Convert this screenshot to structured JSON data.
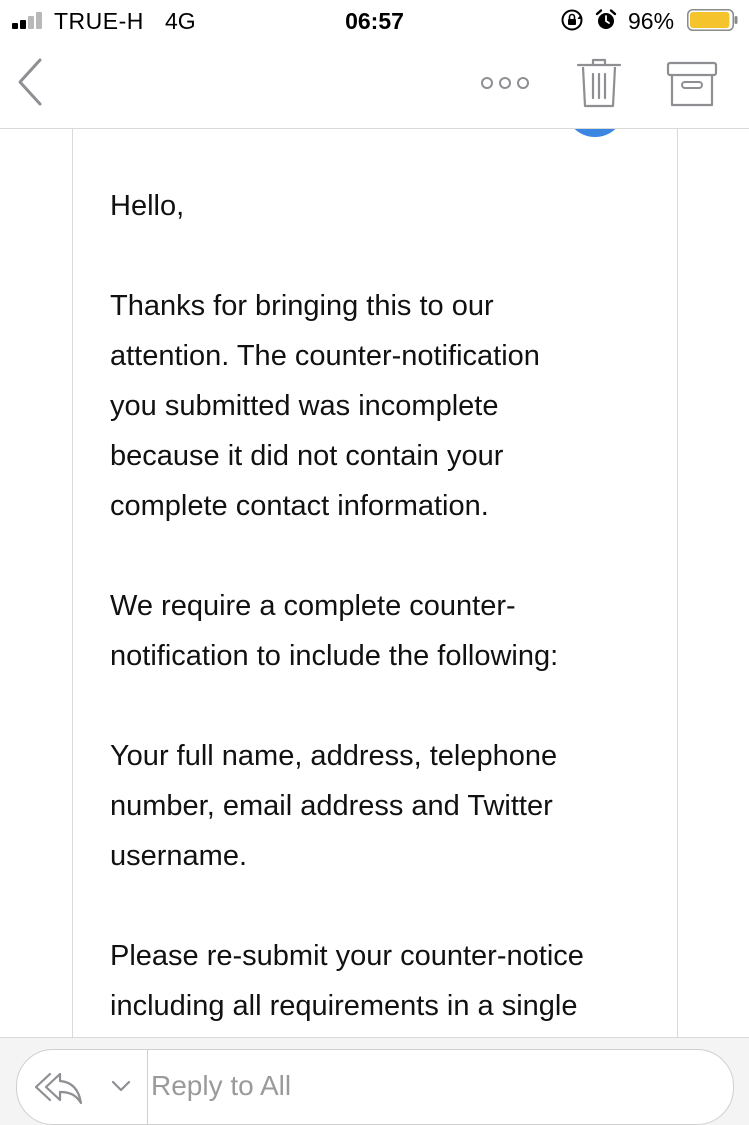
{
  "status_bar": {
    "carrier": "TRUE-H",
    "network": "4G",
    "time": "06:57",
    "battery_percent": "96%",
    "battery_level": 0.96,
    "battery_color": "#f5c32c",
    "signal_bars_active": 2,
    "signal_bars_total": 4
  },
  "toolbar": {
    "back_icon": "chevron-left-icon",
    "more_icon": "more-horizontal-icon",
    "trash_icon": "trash-icon",
    "archive_icon": "archive-icon",
    "accent_color": "#8e8e93"
  },
  "message": {
    "avatar_color": "#3b86e0",
    "paragraphs": [
      "Hello,",
      "Thanks for bringing this to our\nattention. The counter-notification\nyou submitted was incomplete\nbecause it did not contain your\ncomplete contact information.",
      "We require a complete counter-\nnotification to include the following:",
      "Your full name, address, telephone\nnumber, email address and Twitter\nusername.",
      "Please re-submit your counter-notice\nincluding all requirements in a single"
    ]
  },
  "reply_bar": {
    "placeholder": "Reply to All",
    "reply_icon": "reply-all-icon",
    "dropdown_icon": "chevron-down-icon"
  }
}
